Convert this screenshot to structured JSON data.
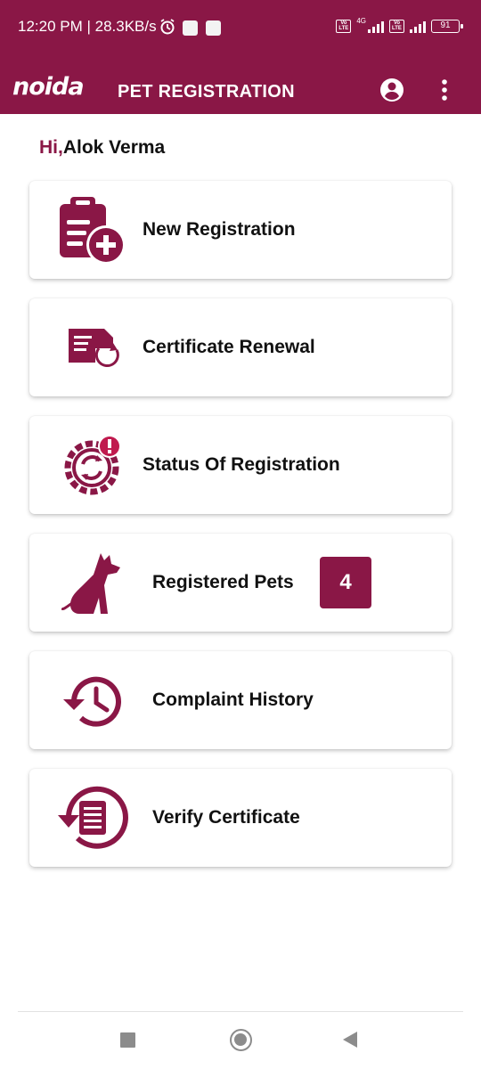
{
  "status_bar": {
    "time_speed": "12:20 PM | 28.3KB/s",
    "network_label": "4G",
    "volte_label": "Vo LTE",
    "battery_level": "91"
  },
  "app_bar": {
    "logo_text": "noida",
    "title": "PET REGISTRATION",
    "profile_icon": "account-circle-icon",
    "menu_icon": "more-vertical-icon"
  },
  "greeting": {
    "prefix": "Hi,",
    "user_name": "Alok Verma"
  },
  "menu": {
    "items": [
      {
        "label": "New Registration",
        "icon": "clipboard-add-icon"
      },
      {
        "label": "Certificate Renewal",
        "icon": "document-refresh-icon"
      },
      {
        "label": "Status Of Registration",
        "icon": "gear-alert-icon"
      },
      {
        "label": "Registered Pets",
        "icon": "dog-icon",
        "count": "4"
      },
      {
        "label": "Complaint History",
        "icon": "history-icon"
      },
      {
        "label": "Verify Certificate",
        "icon": "document-history-icon"
      }
    ]
  },
  "colors": {
    "brand": "#8a1746",
    "card_background": "#ffffff",
    "text": "#111111"
  }
}
